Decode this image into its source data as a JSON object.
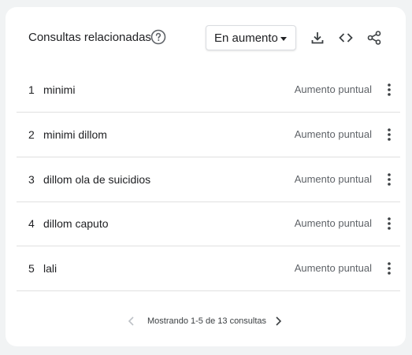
{
  "widget": {
    "title": "Consultas relacionadas",
    "help_icon": "help-circle-icon",
    "filter": {
      "selected": "En aumento"
    },
    "tools": [
      "download-icon",
      "embed-code-icon",
      "share-icon"
    ]
  },
  "rows": [
    {
      "rank": "1",
      "term": "minimi",
      "value": "Aumento puntual"
    },
    {
      "rank": "2",
      "term": "minimi dillom",
      "value": "Aumento puntual"
    },
    {
      "rank": "3",
      "term": "dillom ola de suicidios",
      "value": "Aumento puntual"
    },
    {
      "rank": "4",
      "term": "dillom caputo",
      "value": "Aumento puntual"
    },
    {
      "rank": "5",
      "term": "lali",
      "value": "Aumento puntual"
    }
  ],
  "pagination": {
    "text": "Mostrando 1-5 de 13 consultas"
  },
  "colors": {
    "text": "#202124",
    "secondary_text": "#5f6368",
    "icon": "#3c4043",
    "disabled_icon": "#bdc1c6",
    "divider": "#e0e0e0",
    "background": "#f1f3f4",
    "card": "#ffffff"
  }
}
